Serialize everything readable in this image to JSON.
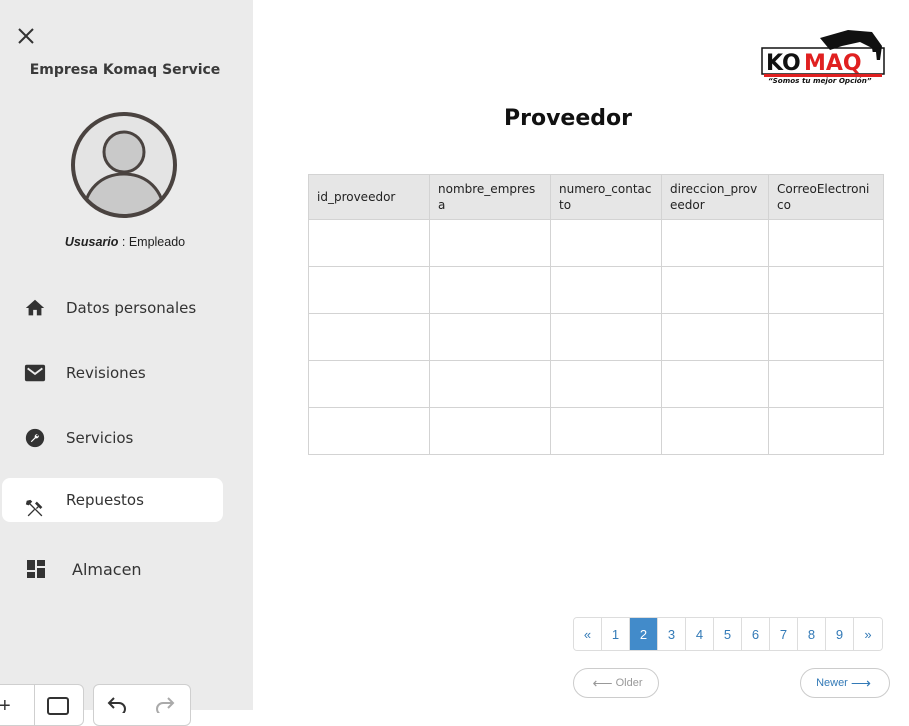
{
  "sidebar": {
    "company": "Empresa Komaq Service",
    "user_role": "Ususario",
    "user_separator": " : ",
    "user_type": "Empleado",
    "items": [
      {
        "label": "Datos personales",
        "icon": "home-icon"
      },
      {
        "label": "Revisiones",
        "icon": "mail-icon"
      },
      {
        "label": "Servicios",
        "icon": "wrench-icon"
      },
      {
        "label": "Repuestos",
        "icon": "tools-icon"
      },
      {
        "label": "Almacen",
        "icon": "dashboard-icon"
      }
    ],
    "active_item": "Repuestos"
  },
  "logo": {
    "brand": "KOMAQ",
    "slogan": "“Somos tu mejor Opción”",
    "accent": "#e02020"
  },
  "page": {
    "title": "Proveedor"
  },
  "table": {
    "columns": [
      "id_proveedor",
      "nombre_empresa",
      "numero_contacto",
      "direccion_proveedor",
      "CorreoElectronico"
    ],
    "rows": [
      [
        "",
        "",
        "",
        "",
        ""
      ],
      [
        "",
        "",
        "",
        "",
        ""
      ],
      [
        "",
        "",
        "",
        "",
        ""
      ],
      [
        "",
        "",
        "",
        "",
        ""
      ],
      [
        "",
        "",
        "",
        "",
        ""
      ]
    ]
  },
  "pagination": {
    "prev": "«",
    "pages": [
      "1",
      "2",
      "3",
      "4",
      "5",
      "6",
      "7",
      "8",
      "9"
    ],
    "current": "2",
    "next": "»",
    "older": "Older",
    "newer": "Newer"
  },
  "colors": {
    "sidebar_bg": "#ebebeb",
    "pager_active": "#428bca",
    "link": "#337ab7"
  }
}
